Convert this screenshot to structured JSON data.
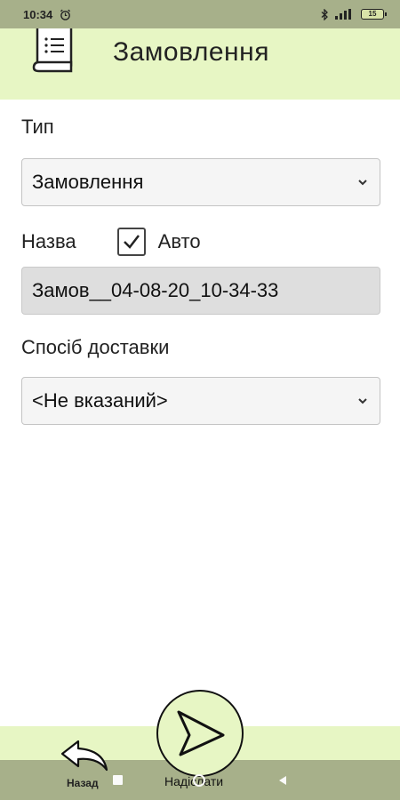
{
  "status_bar": {
    "time": "10:34",
    "battery": "15"
  },
  "header": {
    "title": "Замовлення",
    "icon": "document-list-icon"
  },
  "form": {
    "type_label": "Тип",
    "type_value": "Замовлення",
    "name_label": "Назва",
    "auto_checked": true,
    "auto_label": "Авто",
    "name_value": "Замов__04-08-20_10-34-33",
    "delivery_label": "Спосіб доставки",
    "delivery_value": "<Не вказаний>"
  },
  "bottom": {
    "back_label": "Назад",
    "send_label": "Надіслати",
    "back_icon": "back-arrow-icon",
    "send_icon": "send-icon"
  },
  "colors": {
    "accent": "#e7f6c4",
    "bar": "#a7b08a"
  }
}
